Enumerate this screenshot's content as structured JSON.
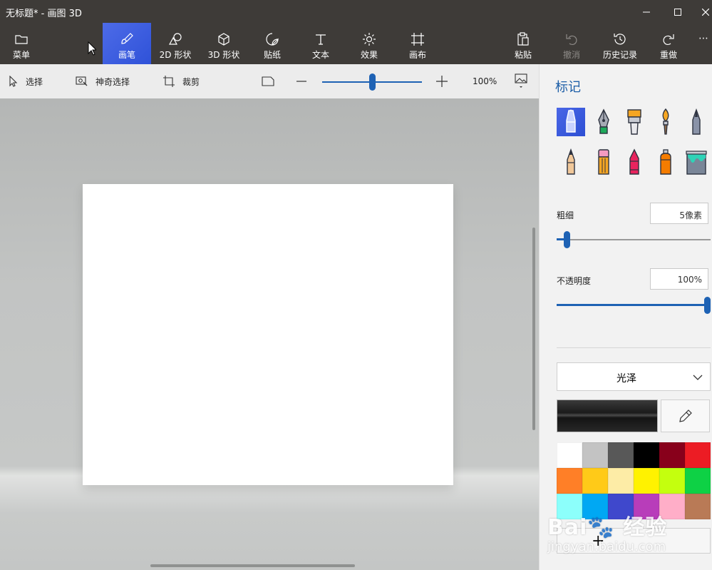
{
  "window": {
    "title": "无标题* - 画图 3D",
    "controls": [
      "minimize-icon",
      "maximize-icon",
      "close-icon"
    ]
  },
  "ribbon": {
    "menu_label": "菜单",
    "tools": [
      {
        "id": "brushes",
        "label": "画笔",
        "icon": "brush-icon",
        "active": true
      },
      {
        "id": "2d-shapes",
        "label": "2D 形状",
        "icon": "2d-shapes-icon"
      },
      {
        "id": "3d-shapes",
        "label": "3D 形状",
        "icon": "3d-cube-icon"
      },
      {
        "id": "stickers",
        "label": "贴纸",
        "icon": "sticker-icon"
      },
      {
        "id": "text",
        "label": "文本",
        "icon": "text-icon"
      },
      {
        "id": "effects",
        "label": "效果",
        "icon": "effects-sun-icon"
      },
      {
        "id": "canvas",
        "label": "画布",
        "icon": "canvas-crop-icon"
      }
    ],
    "actions": [
      {
        "id": "paste",
        "label": "粘贴",
        "icon": "paste-icon"
      },
      {
        "id": "undo",
        "label": "撤消",
        "icon": "undo-icon",
        "disabled": true
      },
      {
        "id": "history",
        "label": "历史记录",
        "icon": "history-icon"
      },
      {
        "id": "redo",
        "label": "重做",
        "icon": "redo-icon"
      }
    ],
    "more": "⋯"
  },
  "toolbar": {
    "select_label": "选择",
    "magic_select_label": "神奇选择",
    "crop_label": "裁剪",
    "zoom_value": "100%",
    "zoom_level": 0.5
  },
  "panel": {
    "title": "标记",
    "brushes": [
      {
        "name": "marker",
        "selected": true
      },
      {
        "name": "calligraphy-pen"
      },
      {
        "name": "oil-brush"
      },
      {
        "name": "watercolor"
      },
      {
        "name": "pixel-pen"
      },
      {
        "name": "pencil"
      },
      {
        "name": "eraser"
      },
      {
        "name": "crayon"
      },
      {
        "name": "spray-can"
      },
      {
        "name": "fill-bucket"
      }
    ],
    "thickness": {
      "label": "粗细",
      "value": "5像素",
      "level": 0.05
    },
    "opacity": {
      "label": "不透明度",
      "value": "100%",
      "level": 1.0
    },
    "finish": {
      "value": "光泽"
    },
    "current_color": "#1b1b1b",
    "swatches": [
      "#ffffff",
      "#c3c3c3",
      "#585858",
      "#000000",
      "#88001b",
      "#ec1c24",
      "#ff7f27",
      "#ffca18",
      "#fdeca6",
      "#fff200",
      "#c4ff0e",
      "#0ed145",
      "#8cfffb",
      "#00a8f3",
      "#3f48cc",
      "#b83dba",
      "#ffaec8",
      "#b97a56"
    ],
    "add_color_symbol": "+"
  },
  "colors": {
    "accent": "#1e62b4",
    "chrome": "#3e3b38"
  },
  "watermark": {
    "text": "Bai🐾 经验",
    "url": "jingyan.baidu.com"
  }
}
